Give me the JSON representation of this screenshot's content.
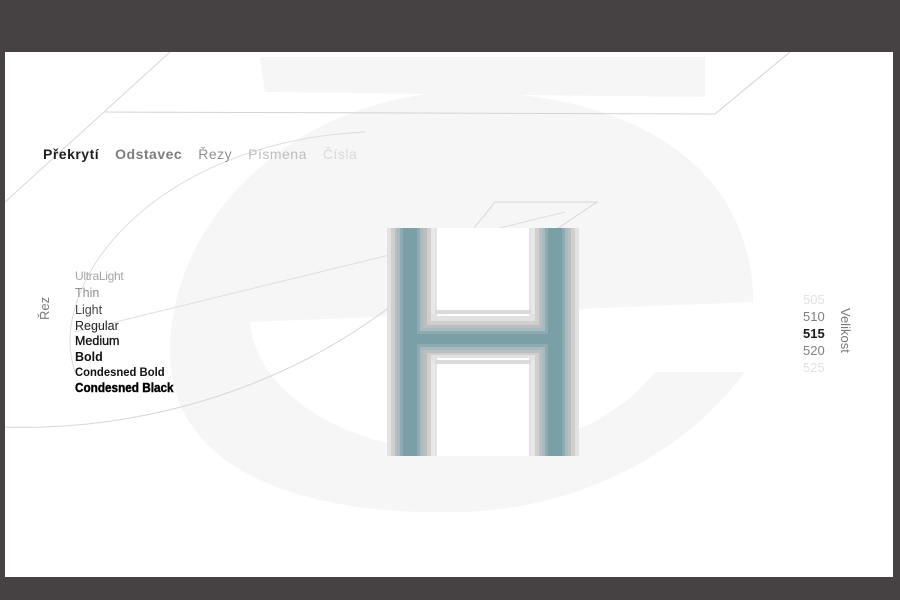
{
  "nav": {
    "items": [
      {
        "label": "Překrytí",
        "state": "active"
      },
      {
        "label": "Odstavec",
        "state": "normal"
      },
      {
        "label": "Řezy",
        "state": "normal"
      },
      {
        "label": "Písmena",
        "state": "muted"
      },
      {
        "label": "Čísla",
        "state": "faded"
      }
    ]
  },
  "weights": {
    "axis_label": "Řez",
    "items": [
      "UltraLight",
      "Thin",
      "Light",
      "Regular",
      "Medium",
      "Bold",
      "Condesned Bold",
      "Condesned Black"
    ]
  },
  "sizes": {
    "axis_label": "Velikost",
    "items": [
      "505",
      "510",
      "515",
      "520",
      "525"
    ],
    "selected": "515"
  },
  "glyph": {
    "character": "H",
    "overlay_colors": [
      "#dcdcdc",
      "#cfcfcf",
      "#bdbdbd",
      "#a9b9bd",
      "#8eaab0",
      "#7fa0a8"
    ]
  },
  "background_glyph": {
    "character": "e",
    "color": "#f4f4f4"
  },
  "colors": {
    "frame": "#464143",
    "canvas": "#ffffff",
    "accent": "#7fa0a8"
  }
}
